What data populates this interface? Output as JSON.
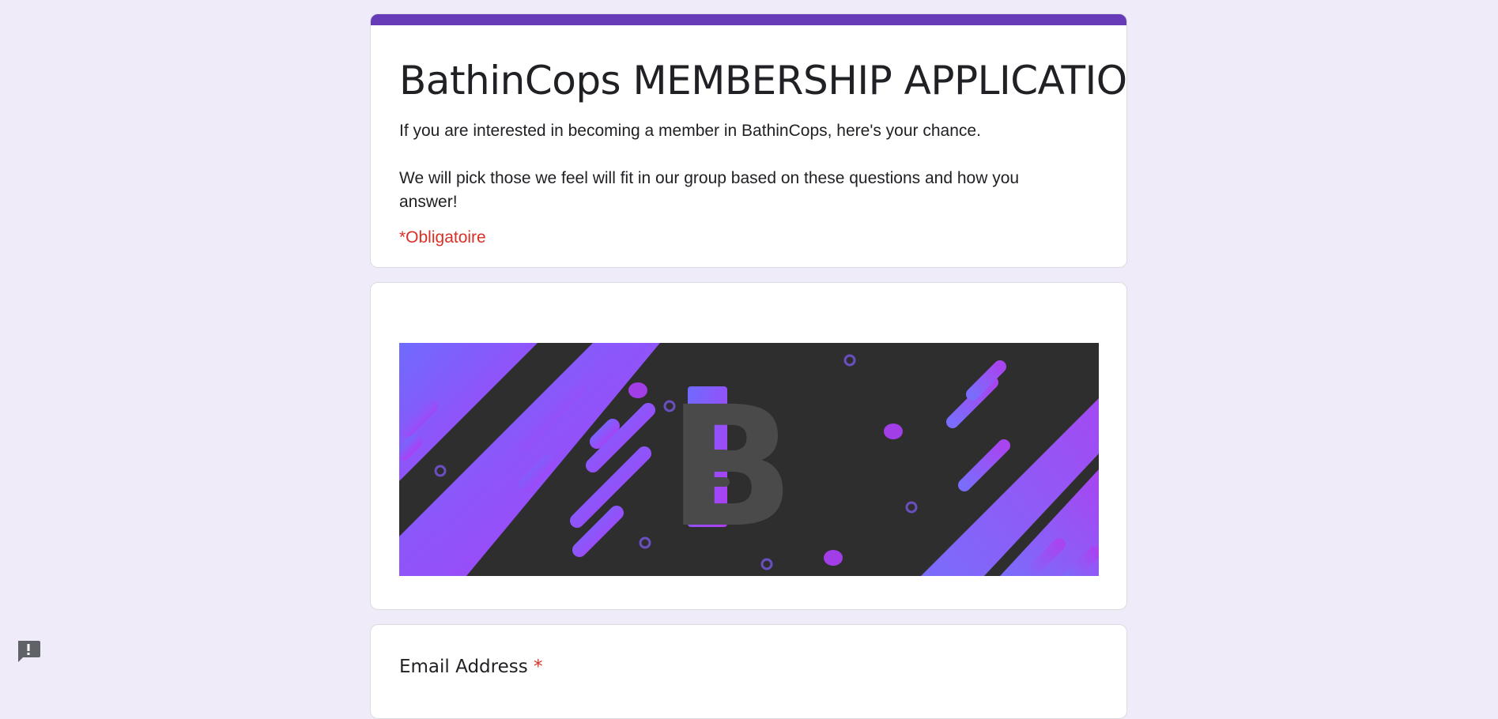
{
  "form": {
    "title": "BathinCops MEMBERSHIP APPLICATION",
    "description_line1": "If you are interested in becoming a member in BathinCops, here's your chance.",
    "description_line2": "We will pick those we feel will fit in our group based on these questions and how you answer!",
    "required_note": "*Obligatoire",
    "accent_color": "#673ab7",
    "background_color": "#f0ebf8"
  },
  "banner": {
    "letter": "B"
  },
  "questions": [
    {
      "label": "Email Address",
      "required_marker": "*"
    }
  ],
  "icons": {
    "feedback": "report-feedback-icon"
  }
}
